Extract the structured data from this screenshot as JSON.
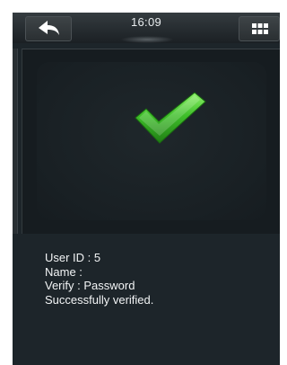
{
  "status_bar": {
    "time": "16:09",
    "back_icon": "back-arrow-icon",
    "menu_icon": "grid-menu-icon"
  },
  "result": {
    "icon": "checkmark-icon",
    "icon_color": "#3fbf2a"
  },
  "info": {
    "user_id": "User ID : 5",
    "name": "Name :",
    "verify": "Verify : Password",
    "message": "Successfully verified."
  }
}
